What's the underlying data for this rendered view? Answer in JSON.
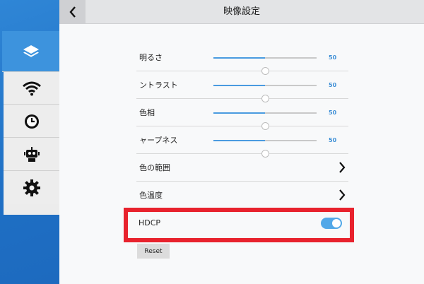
{
  "header": {
    "title": "映像設定"
  },
  "sidebar": {
    "items": [
      {
        "icon": "layers-icon",
        "active": true
      },
      {
        "icon": "wifi-icon",
        "active": false
      },
      {
        "icon": "clock-icon",
        "active": false
      },
      {
        "icon": "robot-icon",
        "active": false
      },
      {
        "icon": "gear-icon",
        "active": false
      }
    ]
  },
  "settings": {
    "brightness": {
      "label": "明るさ",
      "value": "50",
      "fraction": 0.5
    },
    "contrast": {
      "label": "ントラスト",
      "value": "50",
      "fraction": 0.5
    },
    "hue": {
      "label": "色相",
      "value": "50",
      "fraction": 0.5
    },
    "sharpness": {
      "label": "ャープネス",
      "value": "50",
      "fraction": 0.5
    },
    "color_range": {
      "label": "色の範囲"
    },
    "color_temperature": {
      "label": "色温度"
    },
    "hdcp": {
      "label": "HDCP",
      "enabled": true
    }
  },
  "reset_label": "Reset",
  "colors": {
    "accent": "#3d93dd",
    "highlight": "#e8222d",
    "toggle_on": "#52a8e8"
  }
}
